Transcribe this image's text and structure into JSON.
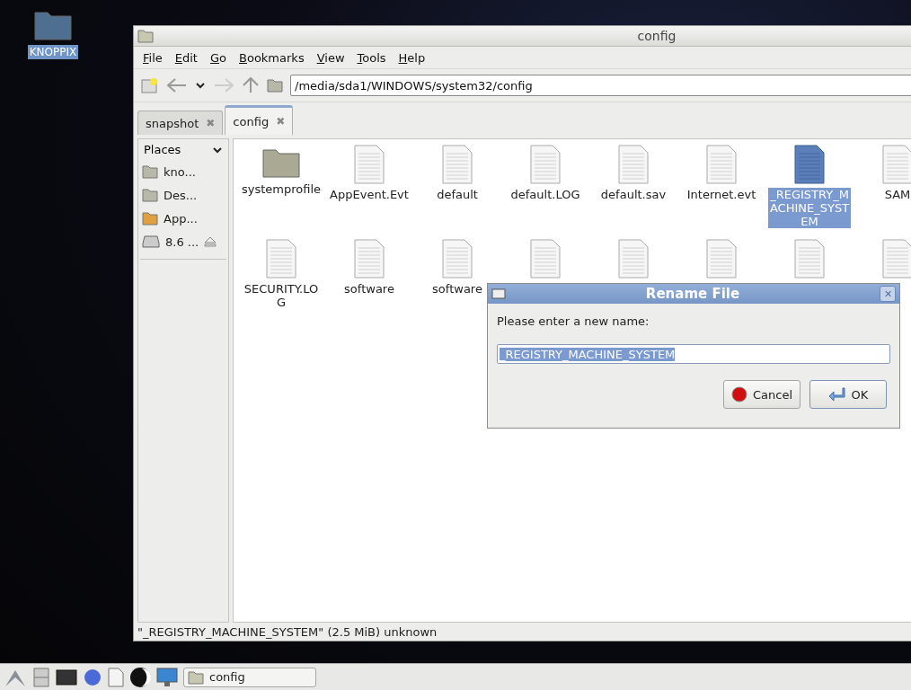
{
  "desktop": {
    "icons": [
      {
        "label": "KNOPPIX",
        "selected": true
      }
    ]
  },
  "window": {
    "title": "config",
    "menu": [
      "File",
      "Edit",
      "Go",
      "Bookmarks",
      "View",
      "Tools",
      "Help"
    ],
    "location": "/media/sda1/WINDOWS/system32/config",
    "tabs": [
      {
        "label": "snapshot",
        "close": "✖",
        "selected": false
      },
      {
        "label": "config",
        "close": "✖",
        "selected": true
      }
    ],
    "sidebar": {
      "title": "Places",
      "items": [
        {
          "label": "kno...",
          "kind": "home"
        },
        {
          "label": "Des...",
          "kind": "desktop"
        },
        {
          "label": "App...",
          "kind": "apps"
        },
        {
          "label": "8.6 ...",
          "kind": "drive"
        }
      ]
    },
    "files": [
      {
        "name": "systemprofile",
        "kind": "folder",
        "selected": false
      },
      {
        "name": "AppEvent.Evt",
        "kind": "file",
        "selected": false
      },
      {
        "name": "default",
        "kind": "file",
        "selected": false
      },
      {
        "name": "default.LOG",
        "kind": "file",
        "selected": false
      },
      {
        "name": "default.sav",
        "kind": "file",
        "selected": false
      },
      {
        "name": "Internet.evt",
        "kind": "file",
        "selected": false
      },
      {
        "name": "_REGISTRY_MACHINE_SYSTEM",
        "kind": "file",
        "selected": true
      },
      {
        "name": "SAM",
        "kind": "file",
        "selected": false
      },
      {
        "name": "SECURITY.LOG",
        "kind": "file",
        "selected": false
      },
      {
        "name": "software",
        "kind": "file",
        "selected": false
      },
      {
        "name": "software",
        "kind": "file",
        "selected": false
      },
      {
        "kind": "file",
        "selected": false
      },
      {
        "kind": "file",
        "selected": false
      },
      {
        "kind": "file",
        "selected": false
      },
      {
        "kind": "file",
        "selected": false
      },
      {
        "kind": "file",
        "selected": false
      }
    ],
    "status": "\"_REGISTRY_MACHINE_SYSTEM\" (2.5 MiB) unknown"
  },
  "dialog": {
    "title": "Rename File",
    "close": "✕",
    "prompt": "Please enter a new name:",
    "value": "_REGISTRY_MACHINE_SYSTEM",
    "buttons": [
      {
        "label": "Cancel",
        "kind": "cancel"
      },
      {
        "label": "OK",
        "kind": "ok"
      }
    ]
  },
  "taskbar": {
    "tasks": [
      {
        "label": "config"
      }
    ]
  }
}
